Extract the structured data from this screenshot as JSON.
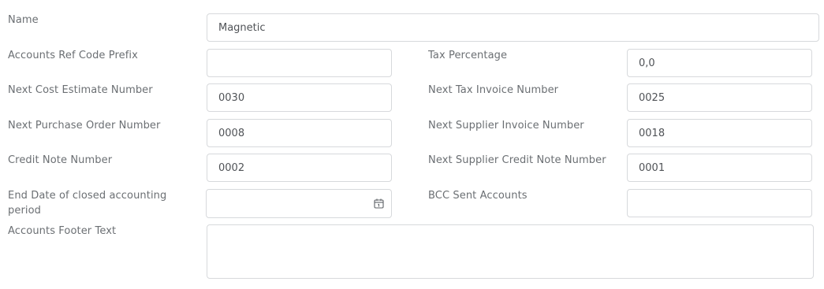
{
  "form": {
    "name": {
      "label": "Name",
      "value": "Magnetic"
    },
    "accounts_ref_code_prefix": {
      "label": "Accounts Ref Code Prefix",
      "value": ""
    },
    "tax_percentage": {
      "label": "Tax Percentage",
      "value": "0,0"
    },
    "next_cost_estimate_number": {
      "label": "Next Cost Estimate Number",
      "value": "0030"
    },
    "next_tax_invoice_number": {
      "label": "Next Tax Invoice Number",
      "value": "0025"
    },
    "next_purchase_order_number": {
      "label": "Next Purchase Order Number",
      "value": "0008"
    },
    "next_supplier_invoice_number": {
      "label": "Next Supplier Invoice Number",
      "value": "0018"
    },
    "credit_note_number": {
      "label": "Credit Note Number",
      "value": "0002"
    },
    "next_supplier_credit_note_number": {
      "label": "Next Supplier Credit Note Number",
      "value": "0001"
    },
    "end_date_closed_period": {
      "label_line1": "End Date of closed accounting",
      "label_line2": "period",
      "value": "",
      "icon": "calendar-icon"
    },
    "bcc_sent_accounts": {
      "label": "BCC Sent Accounts",
      "value": ""
    },
    "accounts_footer_text": {
      "label": "Accounts Footer Text",
      "value": ""
    }
  }
}
